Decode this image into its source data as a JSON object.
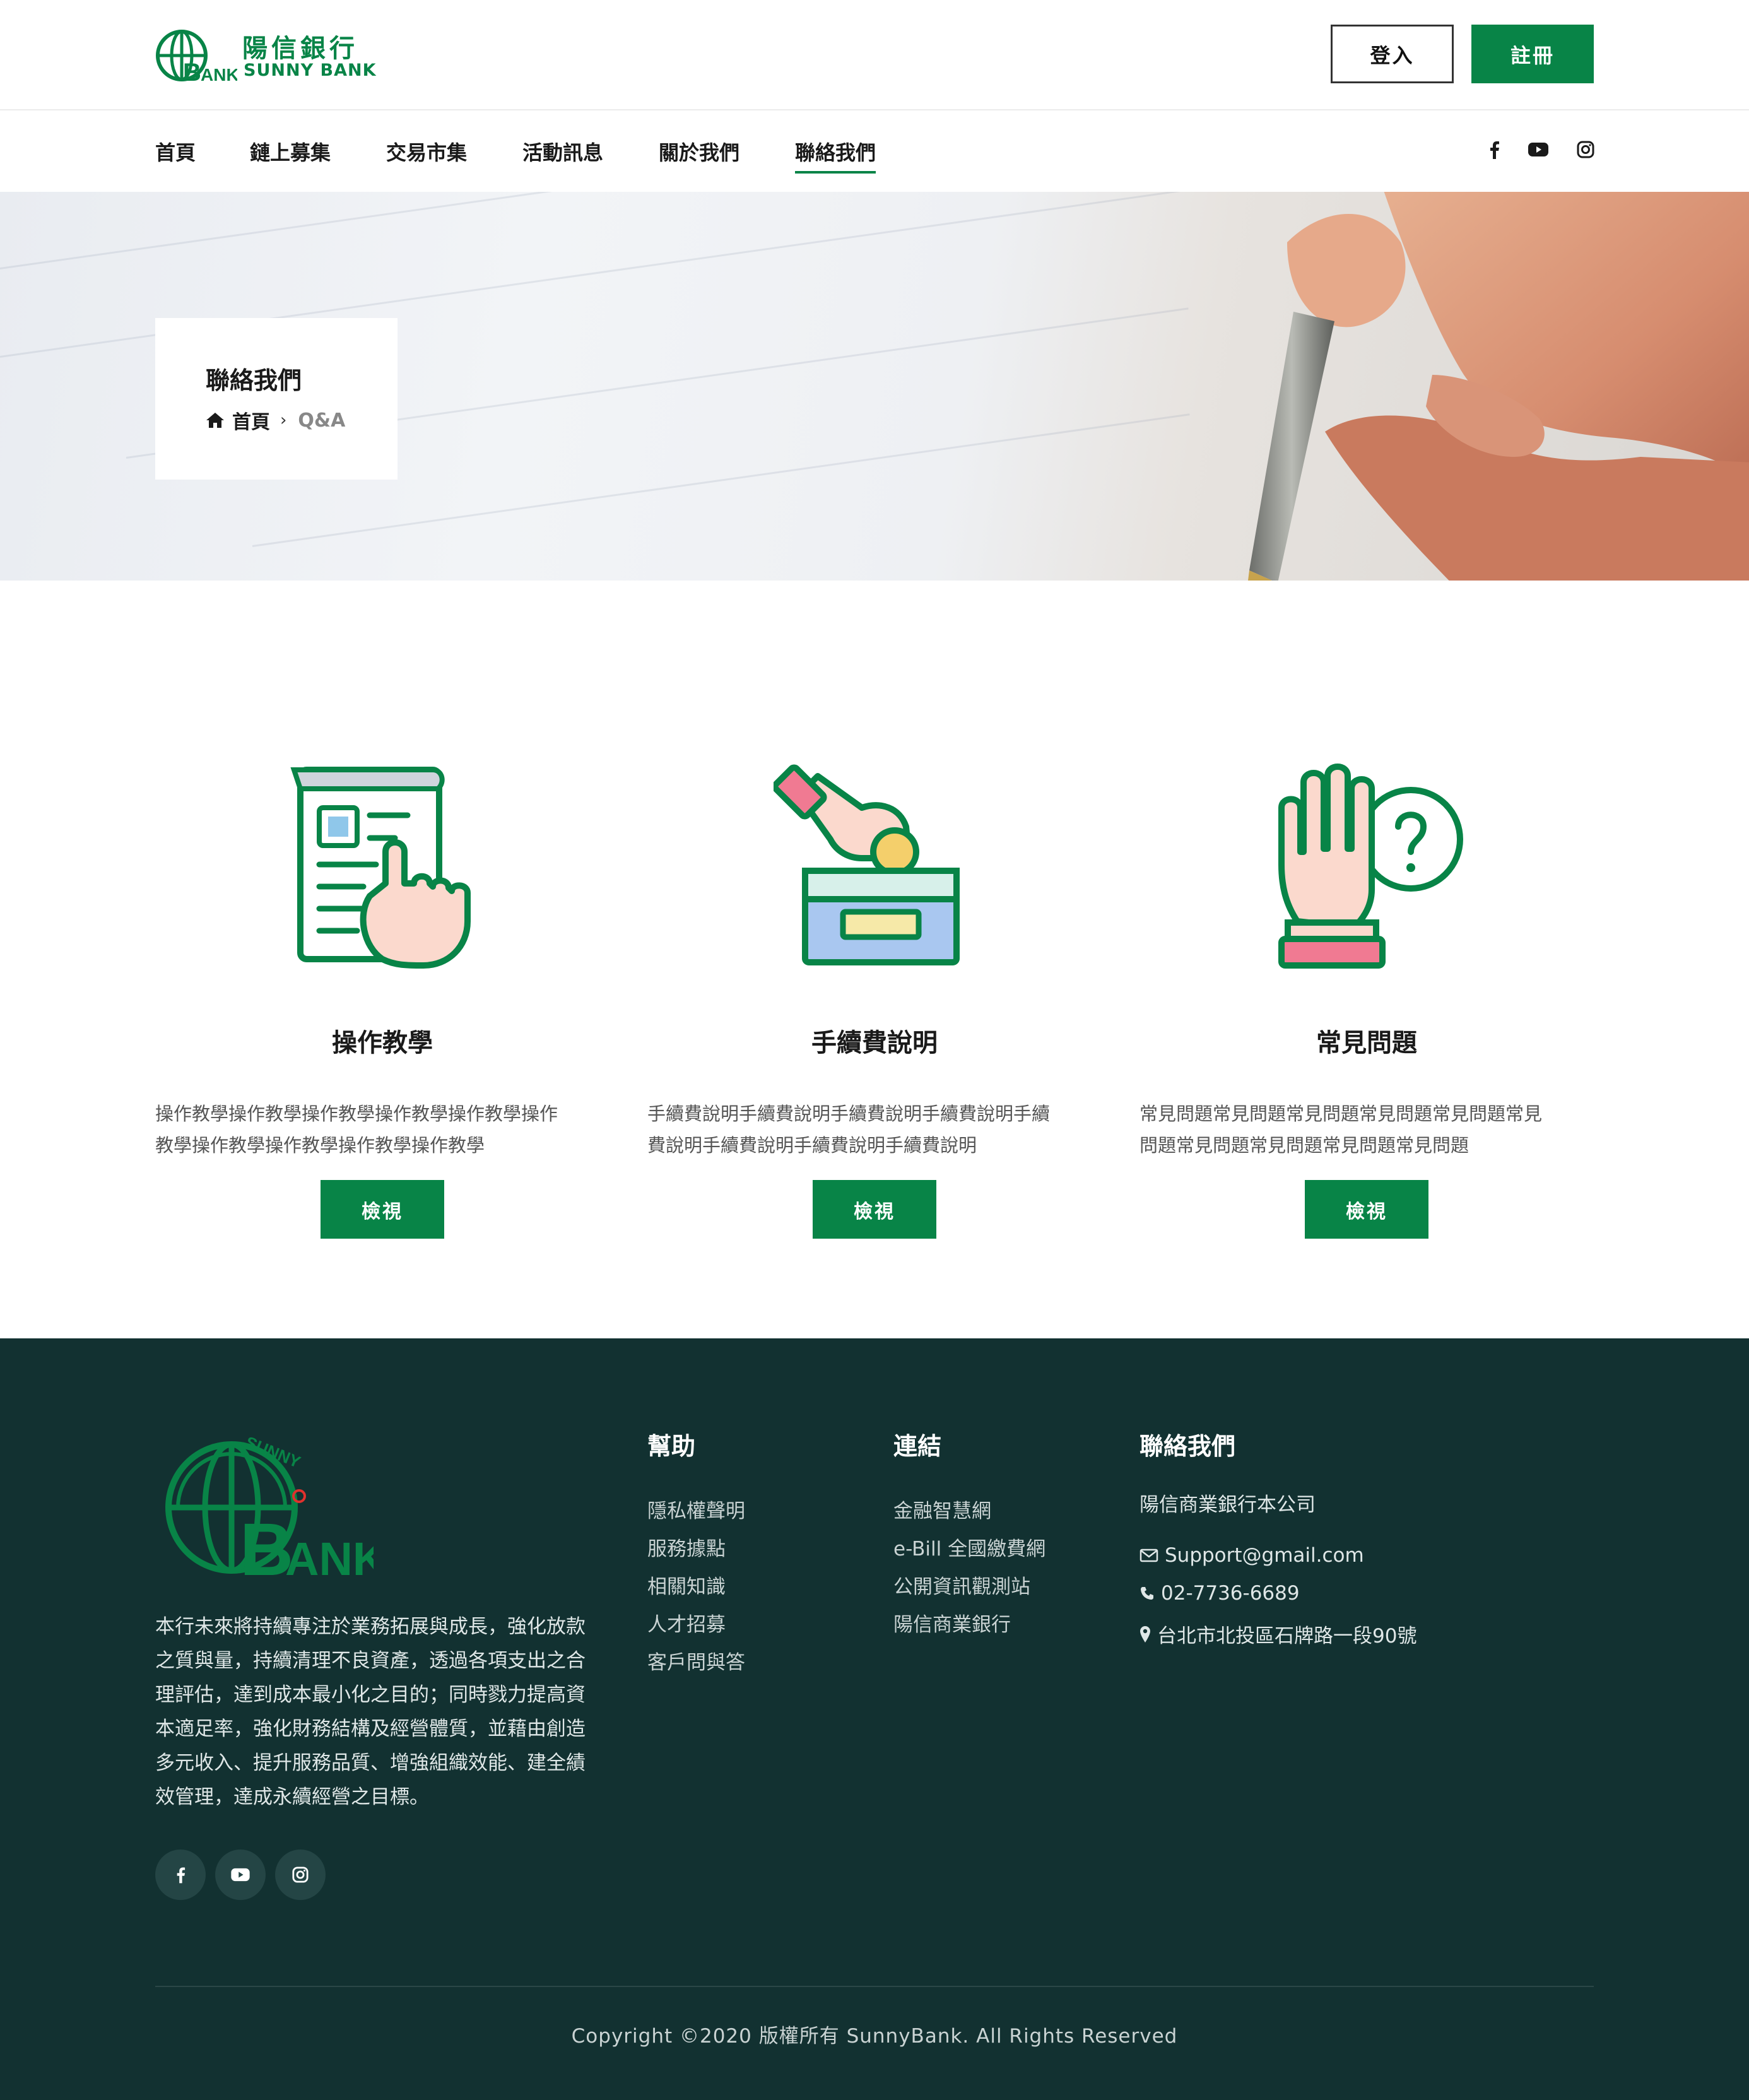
{
  "brand": {
    "name_cn": "陽信銀行",
    "name_en": "SUNNY BANK",
    "primary_color": "#088447",
    "footer_bg": "#123131"
  },
  "header": {
    "login_label": "登入",
    "register_label": "註冊"
  },
  "nav": {
    "items": [
      {
        "label": "首頁"
      },
      {
        "label": "鏈上募集"
      },
      {
        "label": "交易市集"
      },
      {
        "label": "活動訊息"
      },
      {
        "label": "關於我們"
      },
      {
        "label": "聯絡我們",
        "active": true
      }
    ],
    "social_icons": [
      "facebook-icon",
      "youtube-icon",
      "instagram-icon"
    ]
  },
  "hero": {
    "title": "聯絡我們",
    "breadcrumb_home": "首頁",
    "breadcrumb_current": "Q&A"
  },
  "features": [
    {
      "icon": "document-tap-icon",
      "title": "操作教學",
      "desc_line1": "操作教學操作教學操作教學操作教學操作教學操作",
      "desc_line2": "教學操作教學操作教學操作教學操作教學",
      "button": "檢視"
    },
    {
      "icon": "coin-deposit-icon",
      "title": "手續費說明",
      "desc_line1": "手續費說明手續費說明手續費說明手續費說明手續",
      "desc_line2": "費說明手續費說明手續費說明手續費說明",
      "button": "檢視"
    },
    {
      "icon": "hand-question-icon",
      "title": "常見問題",
      "desc_line1": "常見問題常見問題常見問題常見問題常見問題常見",
      "desc_line2": "問題常見問題常見問題常見問題常見問題",
      "button": "檢視"
    }
  ],
  "footer": {
    "about_lines": [
      "本行未來將持續專注於業務拓展與成長，強化放款",
      "之質與量，持續清理不良資產，透過各項支出之合",
      "理評估，達到成本最小化之目的；同時戮力提高資",
      "本適足率，強化財務結構及經營體質，並藉由創造",
      "多元收入、提升服務品質、增強組織效能、建全績",
      "效管理，達成永續經營之目標。"
    ],
    "help_title": "幫助",
    "help_links": [
      "隱私權聲明",
      "服務據點",
      "相關知識",
      "人才招募",
      "客戶問與答"
    ],
    "links_title": "連結",
    "links": [
      "金融智慧網",
      "e-Bill 全國繳費網",
      "公開資訊觀測站",
      "陽信商業銀行"
    ],
    "contact_title": "聯絡我們",
    "company": "陽信商業銀行本公司",
    "email": "Support@gmail.com",
    "phone": "02-7736-6689",
    "address": "台北市北投區石牌路一段90號",
    "copyright": "Copyright ©2020 版權所有 SunnyBank. All Rights Reserved"
  }
}
